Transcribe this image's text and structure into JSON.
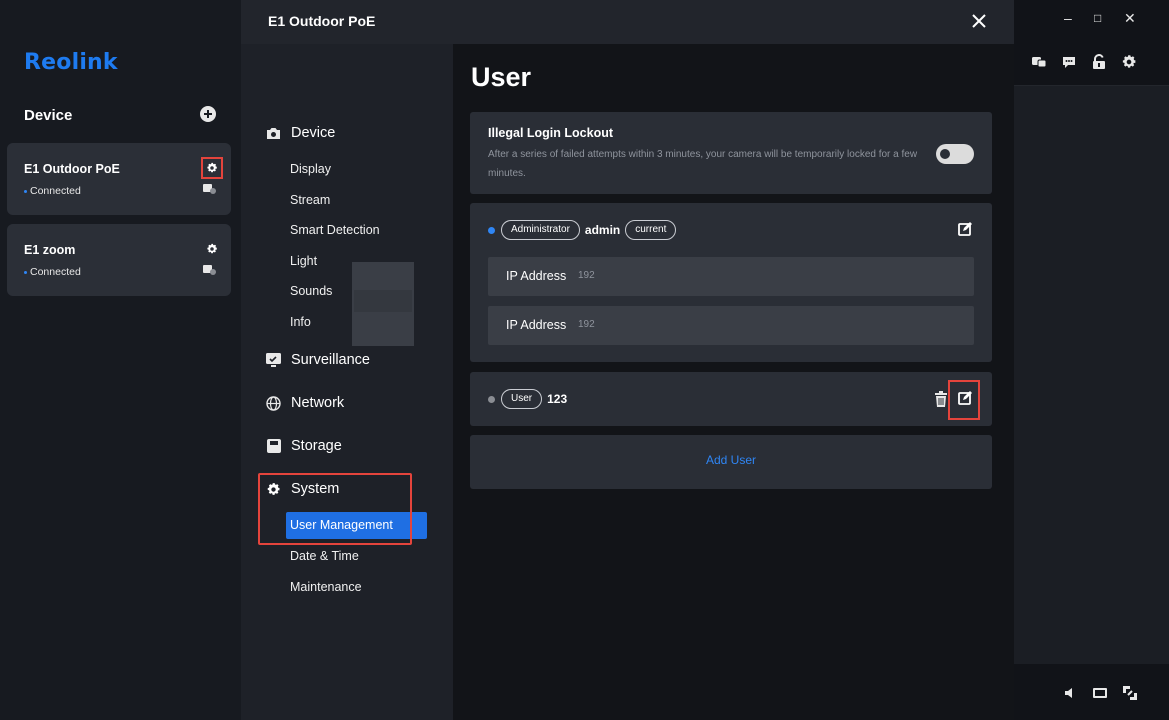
{
  "app": {
    "logo": "Reolink",
    "device_heading": "Device",
    "devices": [
      {
        "name": "E1 Outdoor PoE",
        "status": "Connected"
      },
      {
        "name": "E1 zoom",
        "status": "Connected"
      }
    ],
    "window_controls": {
      "minimize": "–",
      "maximize": "□",
      "close": "✕"
    }
  },
  "modal": {
    "title": "E1 Outdoor PoE",
    "nav": {
      "device": {
        "label": "Device",
        "items": [
          "Display",
          "Stream",
          "Smart Detection",
          "Light",
          "Sounds",
          "Info"
        ]
      },
      "surveillance": {
        "label": "Surveillance"
      },
      "network": {
        "label": "Network"
      },
      "storage": {
        "label": "Storage"
      },
      "system": {
        "label": "System",
        "items": [
          "User Management",
          "Date & Time",
          "Maintenance"
        ],
        "active_item": "User Management"
      }
    },
    "page_title": "User",
    "lockout": {
      "title": "Illegal Login Lockout",
      "description": "After a series of failed attempts within 3 minutes, your camera will be temporarily locked for a few minutes.",
      "enabled": false
    },
    "users": [
      {
        "role": "Administrator",
        "name": "admin",
        "tag": "current",
        "status_color": "#2f86f5",
        "ips": [
          {
            "label": "IP Address",
            "value": "192"
          },
          {
            "label": "IP Address",
            "value": "192"
          }
        ]
      },
      {
        "role": "User",
        "name": "123",
        "status_color": "#8a8d93"
      }
    ],
    "add_user_label": "Add User"
  },
  "colors": {
    "accent": "#1f6fe3",
    "highlight": "#e4443c",
    "link": "#2f86f5"
  }
}
